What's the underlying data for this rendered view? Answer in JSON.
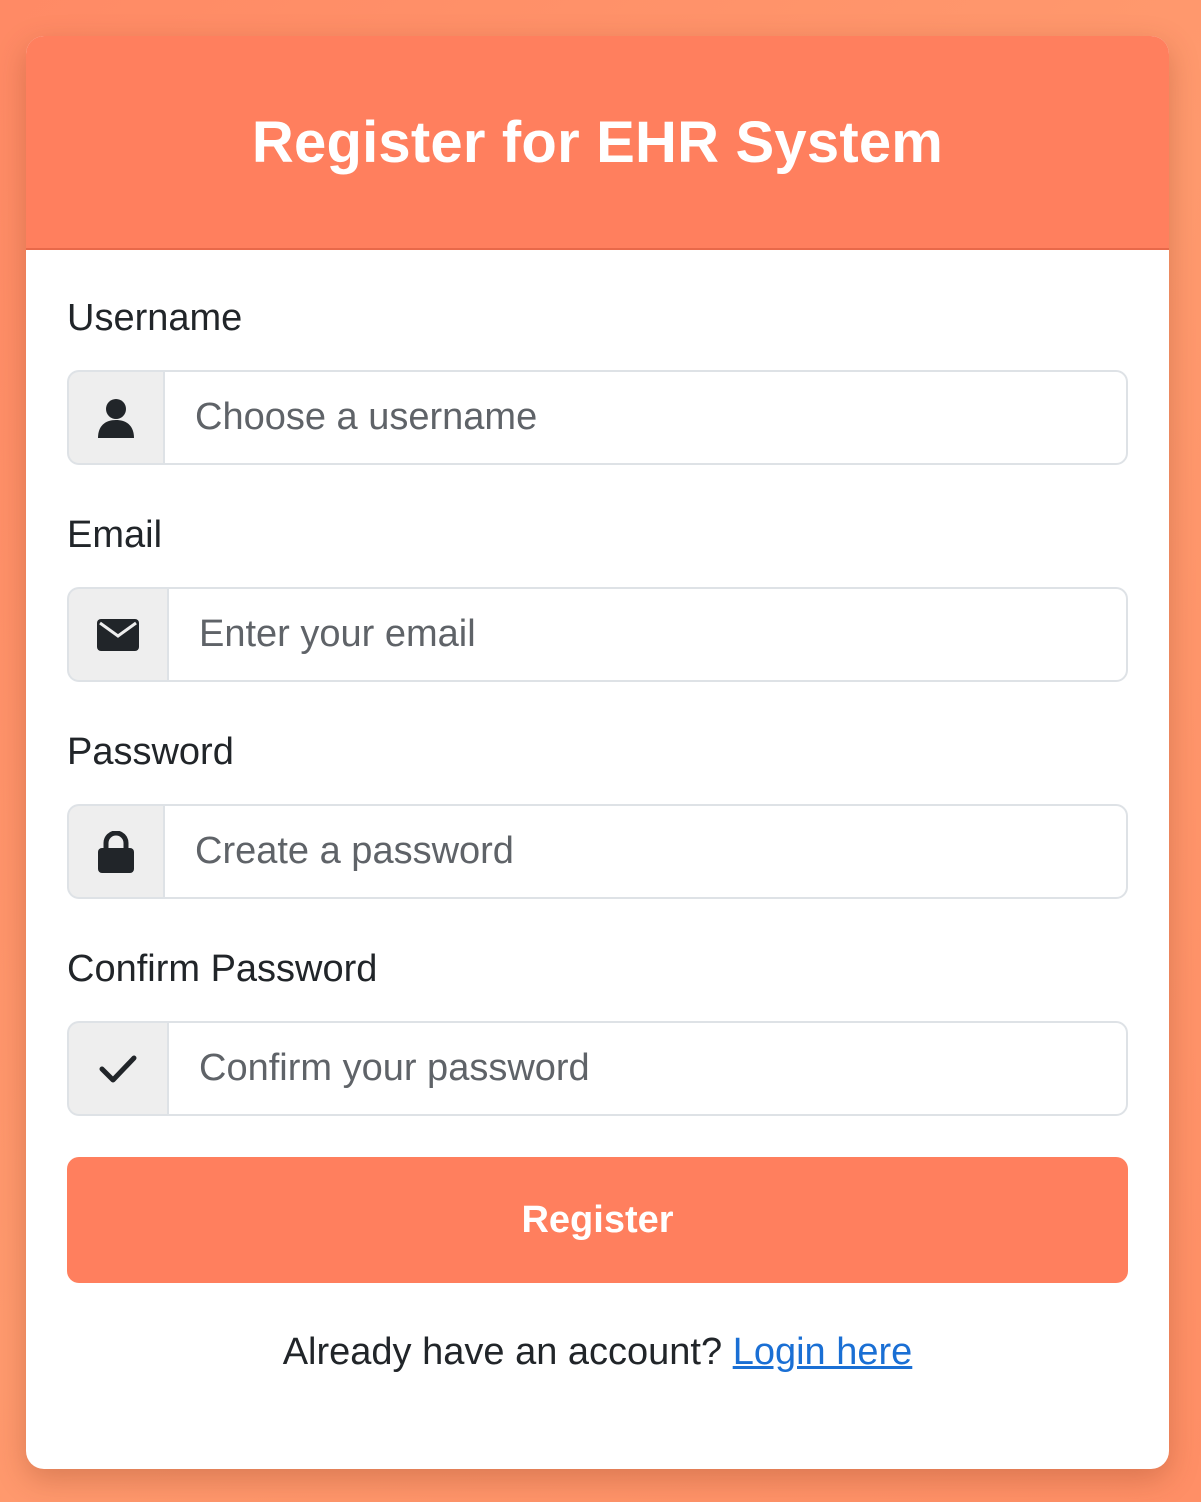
{
  "header": {
    "title": "Register for EHR System"
  },
  "form": {
    "username": {
      "label": "Username",
      "placeholder": "Choose a username",
      "value": "",
      "icon": "user-icon"
    },
    "email": {
      "label": "Email",
      "placeholder": "Enter your email",
      "value": "",
      "icon": "envelope-icon"
    },
    "password": {
      "label": "Password",
      "placeholder": "Create a password",
      "value": "",
      "icon": "lock-icon"
    },
    "confirm_password": {
      "label": "Confirm Password",
      "placeholder": "Confirm your password",
      "value": "",
      "icon": "check-icon"
    },
    "submit_label": "Register"
  },
  "footer": {
    "prompt": "Already have an account?",
    "link_label": "Login here"
  },
  "colors": {
    "accent": "#ff7f5e",
    "link": "#1a6fd4",
    "background": "#ff9a6e"
  }
}
